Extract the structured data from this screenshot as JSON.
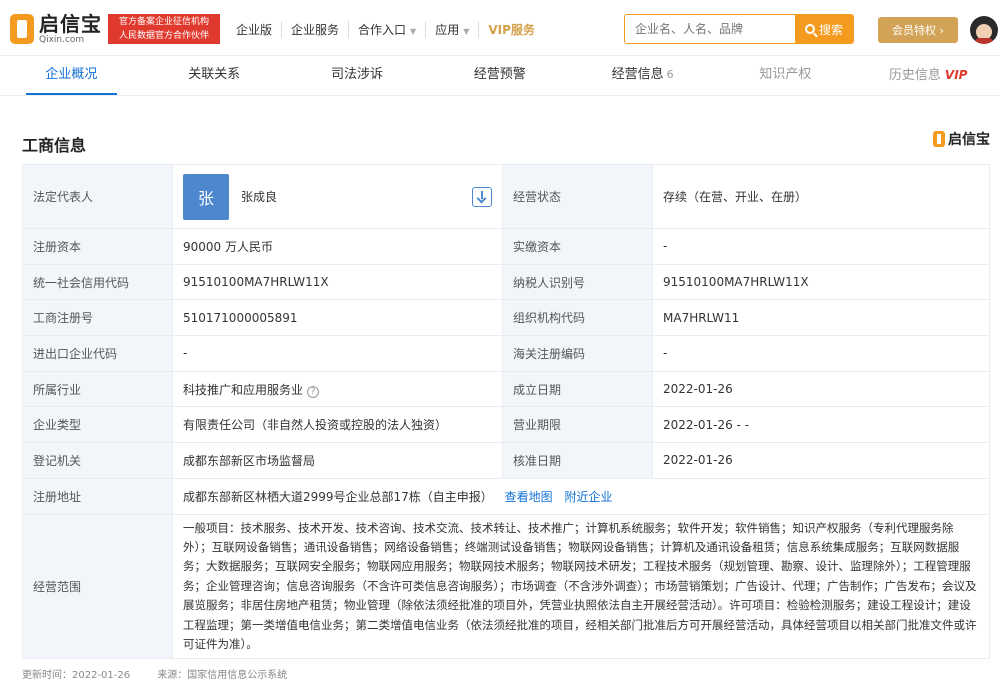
{
  "header": {
    "logo_cn": "启信宝",
    "logo_en": "Qixin.com",
    "official_line1": "官方备案企业征信机构",
    "official_line2": "人民数据官方合作伙伴",
    "nav": [
      {
        "label": "企业版"
      },
      {
        "label": "企业服务"
      },
      {
        "label": "合作入口"
      },
      {
        "label": "应用"
      },
      {
        "label": "VIP服务"
      }
    ],
    "search_placeholder": "企业名、人名、品牌",
    "search_button": "搜索",
    "member_button": "会员特权 ›"
  },
  "tabs": [
    {
      "label": "企业概况"
    },
    {
      "label": "关联关系"
    },
    {
      "label": "司法涉诉"
    },
    {
      "label": "经营预警"
    },
    {
      "label": "经营信息",
      "badge": "6"
    },
    {
      "label": "知识产权"
    },
    {
      "label": "历史信息",
      "tag": "VIP"
    }
  ],
  "section": {
    "title": "工商信息",
    "brand": "启信宝"
  },
  "info": {
    "rep_label": "法定代表人",
    "rep_avatar": "张",
    "rep_name": "张成良",
    "status_label": "经营状态",
    "status_value": "存续（在营、开业、在册）",
    "capital_label": "注册资本",
    "capital_value": "90000 万人民币",
    "paid_label": "实缴资本",
    "paid_value": "-",
    "credit_label": "统一社会信用代码",
    "credit_value": "91510100MA7HRLW11X",
    "tax_label": "纳税人识别号",
    "tax_value": "91510100MA7HRLW11X",
    "reg_label": "工商注册号",
    "reg_value": "510171000005891",
    "org_label": "组织机构代码",
    "org_value": "MA7HRLW11",
    "import_label": "进出口企业代码",
    "import_value": "-",
    "customs_label": "海关注册编码",
    "customs_value": "-",
    "industry_label": "所属行业",
    "industry_value": "科技推广和应用服务业",
    "founded_label": "成立日期",
    "founded_value": "2022-01-26",
    "type_label": "企业类型",
    "type_value": "有限责任公司（非自然人投资或控股的法人独资）",
    "term_label": "营业期限",
    "term_value": "2022-01-26 - -",
    "authority_label": "登记机关",
    "authority_value": "成都东部新区市场监督局",
    "approve_label": "核准日期",
    "approve_value": "2022-01-26",
    "address_label": "注册地址",
    "address_value": "成都东部新区林栖大道2999号企业总部17栋（自主申报）",
    "map_link": "查看地图",
    "nearby_link": "附近企业",
    "scope_label": "经营范围",
    "scope_value": "一般项目：技术服务、技术开发、技术咨询、技术交流、技术转让、技术推广；计算机系统服务；软件开发；软件销售；知识产权服务（专利代理服务除外）；互联网设备销售；通讯设备销售；网络设备销售；终端测试设备销售；物联网设备销售；计算机及通讯设备租赁；信息系统集成服务；互联网数据服务；大数据服务；互联网安全服务；物联网应用服务；物联网技术服务；物联网技术研发；工程技术服务（规划管理、勘察、设计、监理除外）；工程管理服务；企业管理咨询；信息咨询服务（不含许可类信息咨询服务）；市场调查（不含涉外调查）；市场营销策划；广告设计、代理；广告制作；广告发布；会议及展览服务；非居住房地产租赁；物业管理（除依法须经批准的项目外，凭营业执照依法自主开展经营活动）。许可项目：检验检测服务；建设工程设计；建设工程监理；第一类增值电信业务；第二类增值电信业务（依法须经批准的项目，经相关部门批准后方可开展经营活动，具体经营项目以相关部门批准文件或许可证件为准）。"
  },
  "footer": {
    "updated": "更新时间：2022-01-26",
    "source": "来源：国家信用信息公示系统"
  },
  "colors": {
    "accent": "#1271d7",
    "brand_orange": "#f39a1f",
    "official_red": "#e03a2f",
    "label_bg": "#f2f6fb"
  }
}
